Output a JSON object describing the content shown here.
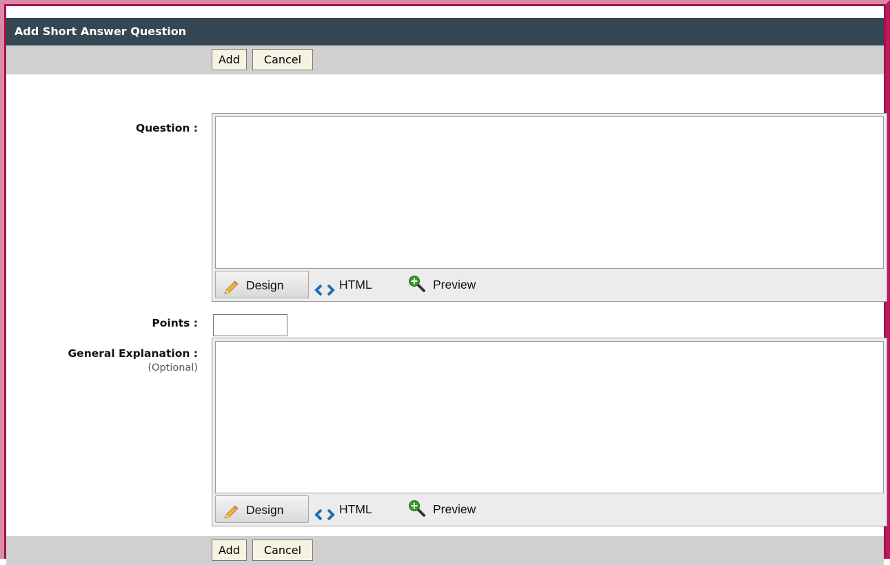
{
  "dialog": {
    "title": "Add Short Answer Question"
  },
  "toolbar": {
    "add_label": "Add",
    "cancel_label": "Cancel"
  },
  "form": {
    "question_label": "Question :",
    "points_label": "Points :",
    "points_value": "",
    "explanation_label": "General Explanation :",
    "explanation_sublabel": "(Optional)"
  },
  "editor_modes": {
    "design": "Design",
    "html": "HTML",
    "preview": "Preview"
  },
  "icons": {
    "design": "pencil-icon",
    "html": "code-brackets-icon",
    "preview": "magnifier-plus-icon"
  },
  "colors": {
    "titlebar": "#354752",
    "toolbar": "#d0d0d0",
    "button_bg": "#f6f3e3",
    "frame_accent": "#c2185b",
    "html_icon": "#1f6fb2",
    "preview_icon": "#3a9a2a"
  }
}
